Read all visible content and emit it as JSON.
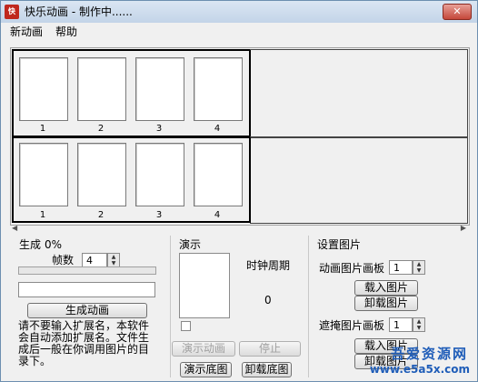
{
  "window": {
    "title": "快乐动画 - 制作中......",
    "icon_text": "快",
    "close_symbol": "✕"
  },
  "menu": {
    "items": [
      {
        "label": "新动画"
      },
      {
        "label": "帮助"
      }
    ]
  },
  "canvas": {
    "rows": [
      {
        "frames": [
          "1",
          "2",
          "3",
          "4"
        ]
      },
      {
        "frames": [
          "1",
          "2",
          "3",
          "4"
        ]
      }
    ]
  },
  "generate": {
    "status_label": "生成",
    "progress_text": "0%",
    "progress": 0,
    "frames_label": "帧数",
    "frames_value": "4",
    "filename_value": "",
    "generate_button": "生成动画",
    "description": "请不要输入扩展名，本软件会自动添加扩展名。文件生成后一般在你调用图片的目录下。"
  },
  "demo": {
    "section_label": "演示",
    "clock_label": "时钟周期",
    "clock_value": "0",
    "play_button": "演示动画",
    "stop_button": "停止",
    "demo_bg_button": "演示底图",
    "unload_bg_button": "卸载底图"
  },
  "settings": {
    "section_label": "设置图片",
    "anim_board_label": "动画图片画板",
    "anim_board_value": "1",
    "load_image_button": "载入图片",
    "unload_image_button": "卸载图片",
    "mask_board_label": "遮掩图片画板",
    "mask_board_value": "1",
    "mask_load_button": "载入图片",
    "mask_unload_button": "卸载图片"
  },
  "watermark": {
    "big": "吾爱资源网",
    "url": "www.e5a5x.com"
  },
  "colors": {
    "title_bar": "#c3d4e8",
    "close_button": "#c4473a",
    "watermark": "#1f5db8"
  }
}
